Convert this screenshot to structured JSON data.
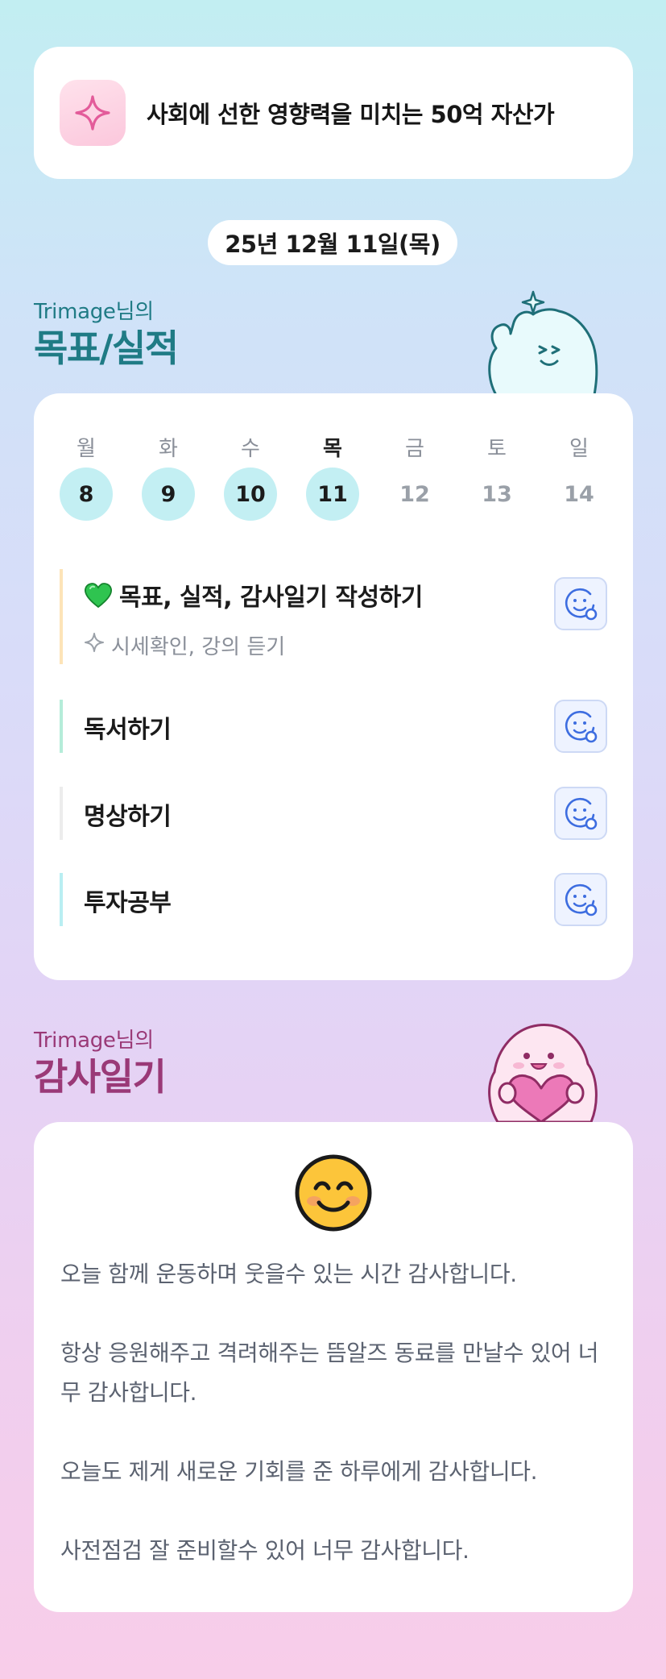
{
  "goal": {
    "text": "사회에 선한 영향력을 미치는 50억 자산가",
    "icon": "sparkle-icon"
  },
  "date": "25년 12월 11일(목)",
  "goals_section": {
    "subtitle": "Trimage님의",
    "title": "목표/실적"
  },
  "week": [
    {
      "name": "월",
      "num": "8",
      "done": true
    },
    {
      "name": "화",
      "num": "9",
      "done": true
    },
    {
      "name": "수",
      "num": "10",
      "done": true
    },
    {
      "name": "목",
      "num": "11",
      "done": true,
      "today": true
    },
    {
      "name": "금",
      "num": "12",
      "done": false
    },
    {
      "name": "토",
      "num": "13",
      "done": false
    },
    {
      "name": "일",
      "num": "14",
      "done": false
    }
  ],
  "tasks": [
    {
      "title": "목표, 실적, 감사일기 작성하기",
      "sub": "시세확인, 강의 듣기",
      "accent": "#fde4b8",
      "icon": "green-heart-icon"
    },
    {
      "title": "독서하기",
      "accent": "#b5ecd9"
    },
    {
      "title": "명상하기",
      "accent": "#ececec"
    },
    {
      "title": "투자공부",
      "accent": "#b9eef2"
    }
  ],
  "diary_section": {
    "subtitle": "Trimage님의",
    "title": "감사일기"
  },
  "diary": {
    "emoji": "smiling-face-icon",
    "paragraphs": [
      "오늘 함께 운동하며 웃을수 있는 시간 감사합니다.",
      "항상 응원해주고 격려해주는 뜸알즈 동료를 만날수 있어 너무 감사합니다.",
      "오늘도 제게 새로운 기회를 준 하루에게 감사합니다.",
      "사전점검 잘 준비할수 있어 너무 감사합니다."
    ]
  },
  "colors": {
    "teal_title": "#1f7b85",
    "pink_title": "#9a3977",
    "done_circle": "#c3eff3"
  }
}
